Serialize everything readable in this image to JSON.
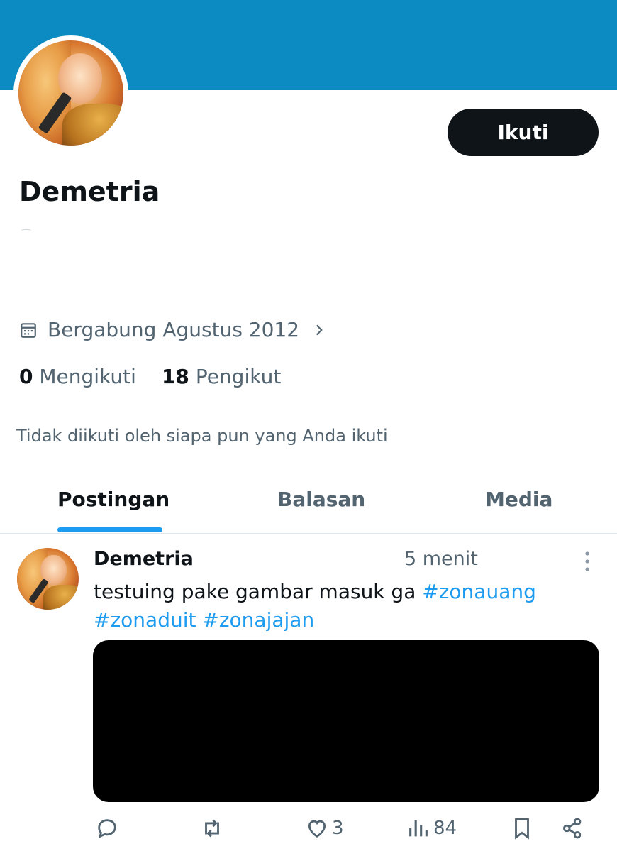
{
  "profile": {
    "display_name": "Demetria",
    "follow_label": "Ikuti",
    "joined": "Bergabung Agustus 2012",
    "following_count": "0",
    "following_label": "Mengikuti",
    "followers_count": "18",
    "followers_label": "Pengikut",
    "not_followed_text": "Tidak diikuti oleh siapa pun yang Anda ikuti"
  },
  "tabs": [
    {
      "label": "Postingan",
      "active": true
    },
    {
      "label": "Balasan",
      "active": false
    },
    {
      "label": "Media",
      "active": false
    }
  ],
  "post": {
    "author": "Demetria",
    "time": "5 menit",
    "text": "testuing pake gambar masuk ga ",
    "hashtags": [
      "#zonauang",
      "#zonaduit",
      "#zonajajan"
    ],
    "likes": "3",
    "views": "84"
  },
  "colors": {
    "banner": "#0b8bc1",
    "accent": "#1d9bf0",
    "text": "#0f1419",
    "muted": "#536471"
  },
  "icons": [
    "calendar-icon",
    "chevron-right-icon",
    "more-icon",
    "reply-icon",
    "repost-icon",
    "like-icon",
    "views-icon",
    "bookmark-icon",
    "share-icon"
  ]
}
